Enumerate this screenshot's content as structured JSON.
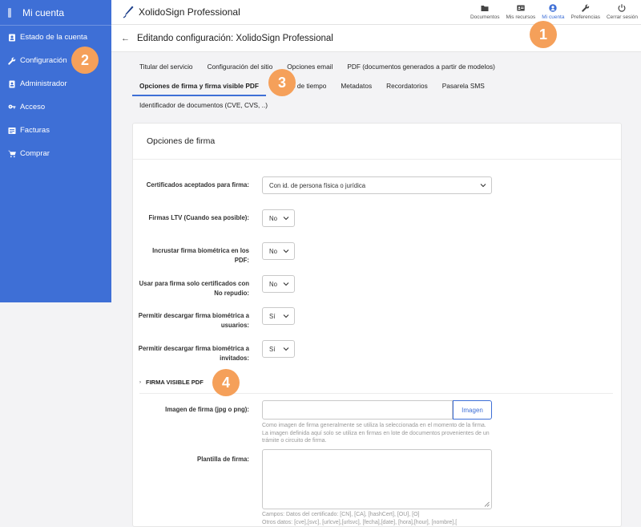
{
  "sidebar": {
    "title": "Mi cuenta",
    "items": [
      {
        "label": "Estado de la cuenta",
        "icon": "user-badge-icon"
      },
      {
        "label": "Configuración",
        "icon": "wrench-icon"
      },
      {
        "label": "Administrador",
        "icon": "admin-icon"
      },
      {
        "label": "Acceso",
        "icon": "key-icon"
      },
      {
        "label": "Facturas",
        "icon": "invoice-icon"
      },
      {
        "label": "Comprar",
        "icon": "cart-icon"
      }
    ]
  },
  "topbar": {
    "app_name": "XolidoSign Professional",
    "nav": [
      {
        "label": "Documentos",
        "icon": "folder-icon"
      },
      {
        "label": "Mis recursos",
        "icon": "id-card-icon"
      },
      {
        "label": "Mi cuenta",
        "icon": "account-icon",
        "active": true
      },
      {
        "label": "Preferencias",
        "icon": "wrench-icon"
      },
      {
        "label": "Cerrar sesión",
        "icon": "power-icon"
      }
    ]
  },
  "page": {
    "title": "Editando configuración: XolidoSign Professional"
  },
  "tabs": {
    "row1": [
      "Titular del servicio",
      "Configuración del sitio",
      "Opciones email",
      "PDF (documentos generados a partir de modelos)"
    ],
    "row2": [
      "Opciones de firma y firma visible PDF",
      "Sellado de tiempo",
      "Metadatos",
      "Recordatorios",
      "Pasarela SMS"
    ],
    "row3": [
      "Identificador de documentos (CVE, CVS, ..)"
    ],
    "active": "Opciones de firma y firma visible PDF"
  },
  "card": {
    "title": "Opciones de firma",
    "fields": [
      {
        "label": "Certificados aceptados para firma:",
        "value": "Con id. de persona física o jurídica"
      },
      {
        "label": "Firmas LTV (Cuando sea posible):",
        "value": "No"
      },
      {
        "label": "Incrustar firma biométrica en los PDF:",
        "value": "No"
      },
      {
        "label": "Usar para firma solo certificados con No repudio:",
        "value": "No"
      },
      {
        "label": "Permitir descargar firma biométrica a usuarios:",
        "value": "Sí"
      },
      {
        "label": "Permitir descargar firma biométrica a invitados:",
        "value": "Sí"
      }
    ],
    "section": "FIRMA VISIBLE PDF",
    "image_field": {
      "label": "Imagen de firma (jpg o png):",
      "button": "Imagen",
      "help": "Como imagen de firma generalmente se utiliza la seleccionada en el momento de la firma. La imagen definida aquí solo se utiliza en firmas en lote de documentos provenientes de un trámite o circuito de firma."
    },
    "template_field": {
      "label": "Plantilla de firma:",
      "help1": "Campos: Datos del certificado: [CN], [CA], [hashCert], [OU], [O]",
      "help2": "Otros datos: [cve],[svc], [urlcve],[urlsvc], [fecha],[date], [hora],[hour], [nombre],["
    }
  },
  "badges": [
    "1",
    "2",
    "3",
    "4"
  ],
  "colors": {
    "accent": "#3e6fd6",
    "badge": "#f5a05a"
  }
}
